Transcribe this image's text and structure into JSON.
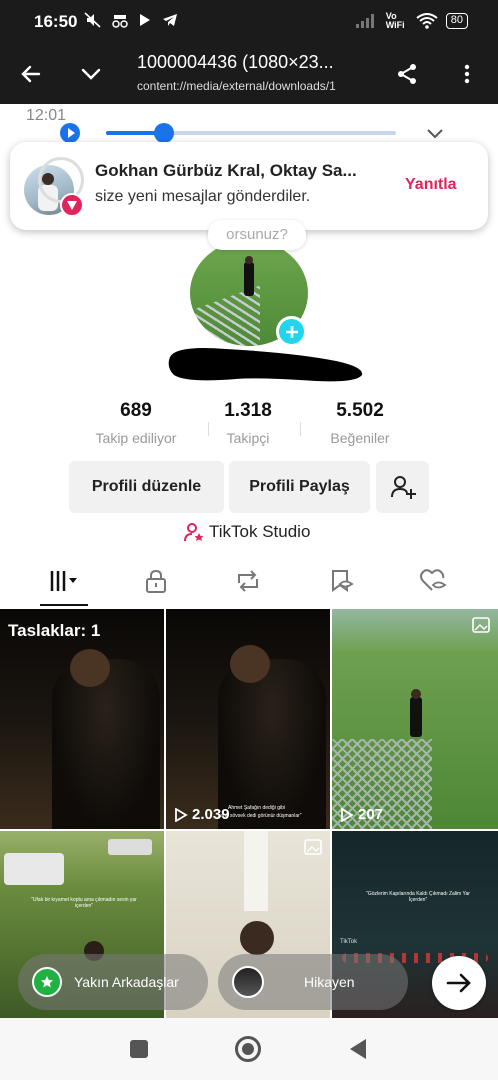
{
  "status_bar": {
    "time": "16:50",
    "battery": "80",
    "network": "Vo WiFi"
  },
  "viewer": {
    "title": "1000004436 (1080×23...",
    "subtitle": "content://media/external/downloads/1"
  },
  "notification": {
    "title": "Gokhan Gürbüz Kral, Oktay Sa...",
    "body": "size yeni mesajlar gönderdiler.",
    "action": "Yanıtla"
  },
  "media_player": {
    "progress": 0.2
  },
  "inner_status": {
    "time": "12:01"
  },
  "profile": {
    "bubble_text": "orsunuz?",
    "stats": [
      {
        "value": "689",
        "label": "Takip ediliyor"
      },
      {
        "value": "1.318",
        "label": "Takipçi"
      },
      {
        "value": "5.502",
        "label": "Beğeniler"
      }
    ],
    "edit_label": "Profili düzenle",
    "share_label": "Profili Paylaş",
    "studio_label": "TikTok Studio"
  },
  "grid": {
    "drafts_label": "Taslaklar: 1",
    "views": [
      "2.039",
      "207"
    ],
    "captions": [
      "Ahmet Şafağın dediği gibi",
      "\"sana sövsek dedi görünür düşmanlar\"",
      "\"Gözlerim Kapılarında Kaldı Çıkmadı Zalim Yar İçerden\"",
      "\"Ufak bir kıyamet koptu ama çıkmadın sesin yar içerden\""
    ],
    "tiktok_mark": "TikTok"
  },
  "bottom_bar": {
    "close_friends": "Yakın Arkadaşlar",
    "story": "Hikayen"
  }
}
